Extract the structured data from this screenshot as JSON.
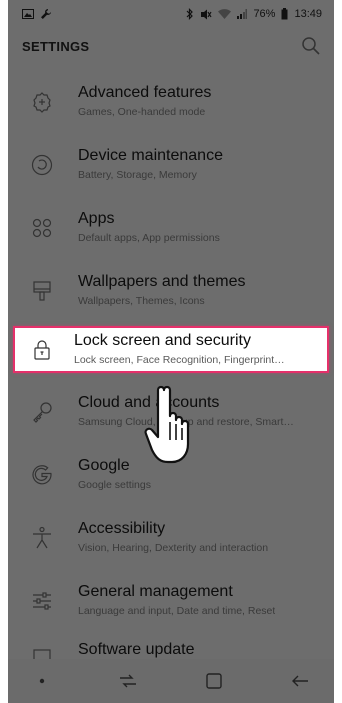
{
  "status_bar": {
    "battery_percent": "76%",
    "time": "13:49",
    "left_icons": [
      "gallery-notification-icon",
      "wrench-icon"
    ],
    "right_icons": [
      "bluetooth-icon",
      "mute-icon",
      "wifi-icon",
      "signal-icon",
      "battery-icon"
    ]
  },
  "header": {
    "title": "SETTINGS",
    "search_icon": "search-icon"
  },
  "settings": [
    {
      "title": "Advanced features",
      "subtitle": "Games, One-handed mode",
      "icon": "gear-plus-icon"
    },
    {
      "title": "Device maintenance",
      "subtitle": "Battery, Storage, Memory",
      "icon": "maintenance-icon"
    },
    {
      "title": "Apps",
      "subtitle": "Default apps, App permissions",
      "icon": "apps-grid-icon"
    },
    {
      "title": "Wallpapers and themes",
      "subtitle": "Wallpapers, Themes, Icons",
      "icon": "brush-icon"
    },
    {
      "title": "Lock screen and security",
      "subtitle": "Lock screen, Face Recognition, Fingerprint…",
      "icon": "lock-icon",
      "highlighted": true
    },
    {
      "title": "Cloud and accounts",
      "subtitle": "Samsung Cloud, Backup and restore, Smart…",
      "icon": "key-icon"
    },
    {
      "title": "Google",
      "subtitle": "Google settings",
      "icon": "google-icon"
    },
    {
      "title": "Accessibility",
      "subtitle": "Vision, Hearing, Dexterity and interaction",
      "icon": "accessibility-icon"
    },
    {
      "title": "General management",
      "subtitle": "Language and input, Date and time, Reset",
      "icon": "sliders-icon"
    },
    {
      "title": "Software update",
      "subtitle": "",
      "icon": "software-update-icon"
    }
  ],
  "navbar": {
    "buttons": [
      "dot-icon",
      "recent-apps-icon",
      "home-icon",
      "back-icon"
    ]
  },
  "colors": {
    "overlay": "#6d6d6d",
    "highlight_border": "#e5306a",
    "highlight_bg": "#ffffff"
  }
}
